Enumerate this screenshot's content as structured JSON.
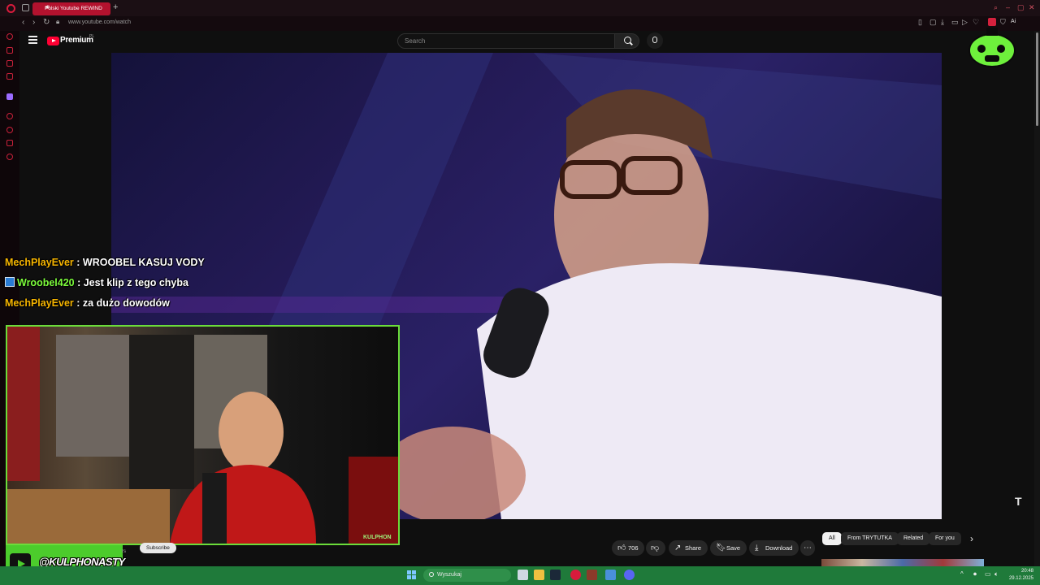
{
  "browser": {
    "tab_title": "Polski Youtube REWIND",
    "url": "www.youtube.com/watch",
    "new_tab_symbol": "+",
    "ai_label": "Ai"
  },
  "youtube": {
    "logo_text": "Premium",
    "country": "PL",
    "search_placeholder": "Search"
  },
  "chat": [
    {
      "user": "MechPlayEver",
      "message": "WROOBEL KASUJ VODY",
      "color": "#f5b400",
      "badge": false
    },
    {
      "user": "Wroobel420",
      "message": "Jest klip z tego chyba",
      "color": "#7cfc3c",
      "badge": true
    },
    {
      "user": "MechPlayEver",
      "message": "za dużo dowodów",
      "color": "#f5b400",
      "badge": false
    }
  ],
  "webcam": {
    "name_tag": "KULPHON"
  },
  "channel_banner": {
    "handle": "@KULPHONASTY",
    "subscribe_label": "Subscribe",
    "sub_count": "rs"
  },
  "actions": {
    "like_count": "706",
    "share_label": "Share",
    "save_label": "Save",
    "download_label": "Download"
  },
  "chips": [
    "All",
    "From TRYTUTKA",
    "Related",
    "For you"
  ],
  "taskbar": {
    "search_placeholder": "Wyszukaj",
    "time": "20:48",
    "date": "29.12.2025"
  },
  "colors": {
    "accent_red": "#ff0033",
    "overlay_green": "#6bdc3a",
    "taskbar_green": "#1f7a3a"
  }
}
